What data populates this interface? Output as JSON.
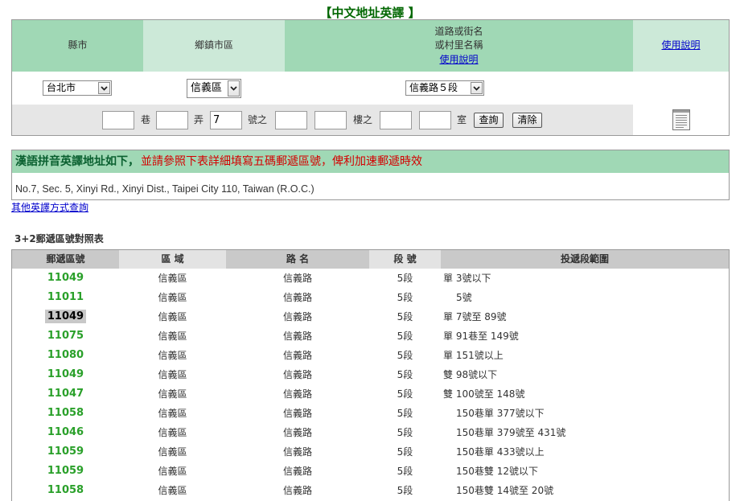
{
  "title": "【中文地址英譯 】",
  "colors": {
    "green_dark": "#a0d8b5",
    "green_light": "#cce9d8",
    "zip_green": "#2aa02a",
    "note_red": "#d40000",
    "link_blue": "#0000cc",
    "title_green": "#006600"
  },
  "icons": {
    "dropdown": "chevron-down-icon",
    "help_document": "document-icon"
  },
  "form": {
    "headers": {
      "county": "縣市",
      "district": "鄉鎮市區",
      "road_line1": "道路或街名",
      "road_line2": "或村里名稱",
      "road_help_link": "使用說明",
      "help_link": "使用說明"
    },
    "county_select": {
      "selected": "台北市"
    },
    "district_select": {
      "selected": "信義區"
    },
    "road_select": {
      "selected": "信義路５段"
    },
    "fields": [
      {
        "value": "",
        "label": "巷"
      },
      {
        "value": "",
        "label": "弄"
      },
      {
        "value": "7",
        "label": "號之"
      },
      {
        "value": ""
      },
      {
        "value": "",
        "label": "樓之"
      },
      {
        "value": ""
      },
      {
        "value": "",
        "label": "室"
      }
    ],
    "query_button": "查詢",
    "clear_button": "清除"
  },
  "result": {
    "heading": "漢語拼音英譯地址如下，",
    "note": "並請參照下表詳細填寫五碼郵遞區號，俾利加速郵遞時效",
    "address": "No.7, Sec. 5, Xinyi Rd., Xinyi Dist., Taipei City 110, Taiwan (R.O.C.)"
  },
  "other_translation_link": "其他英譯方式查詢",
  "zip_table": {
    "caption": "3+2郵遞區號對照表",
    "columns": [
      "郵遞區號",
      "區 域",
      "路 名",
      "段 號",
      "投遞段範圍"
    ],
    "rows": [
      {
        "zip": "11049",
        "area": "信義區",
        "road": "信義路",
        "section": "5段",
        "range": "單 3號以下"
      },
      {
        "zip": "11011",
        "area": "信義區",
        "road": "信義路",
        "section": "5段",
        "range": "5號"
      },
      {
        "zip": "11049",
        "area": "信義區",
        "road": "信義路",
        "section": "5段",
        "range": "單 7號至 89號",
        "highlight": true
      },
      {
        "zip": "11075",
        "area": "信義區",
        "road": "信義路",
        "section": "5段",
        "range": "單 91巷至 149號"
      },
      {
        "zip": "11080",
        "area": "信義區",
        "road": "信義路",
        "section": "5段",
        "range": "單 151號以上"
      },
      {
        "zip": "11049",
        "area": "信義區",
        "road": "信義路",
        "section": "5段",
        "range": "雙 98號以下"
      },
      {
        "zip": "11047",
        "area": "信義區",
        "road": "信義路",
        "section": "5段",
        "range": "雙 100號至 148號"
      },
      {
        "zip": "11058",
        "area": "信義區",
        "road": "信義路",
        "section": "5段",
        "range": "150巷單 377號以下"
      },
      {
        "zip": "11046",
        "area": "信義區",
        "road": "信義路",
        "section": "5段",
        "range": "150巷單 379號至 431號"
      },
      {
        "zip": "11059",
        "area": "信義區",
        "road": "信義路",
        "section": "5段",
        "range": "150巷單 433號以上"
      },
      {
        "zip": "11059",
        "area": "信義區",
        "road": "信義路",
        "section": "5段",
        "range": "150巷雙 12號以下"
      },
      {
        "zip": "11058",
        "area": "信義區",
        "road": "信義路",
        "section": "5段",
        "range": "150巷雙 14號至 20號"
      }
    ]
  }
}
